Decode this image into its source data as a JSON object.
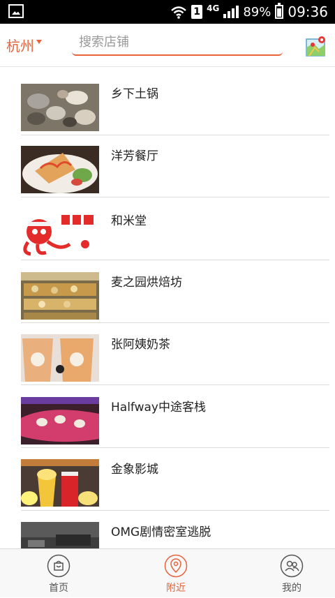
{
  "status_bar": {
    "sim": "1",
    "network": "4G",
    "battery": "89%",
    "time": "09:36"
  },
  "header": {
    "city": "杭州",
    "search_placeholder": "搜索店铺"
  },
  "stores": [
    {
      "name": "乡下土锅"
    },
    {
      "name": "洋芳餐厅"
    },
    {
      "name": "和米堂"
    },
    {
      "name": "麦之园烘焙坊"
    },
    {
      "name": "张阿姨奶茶"
    },
    {
      "name": "Halfway中途客栈"
    },
    {
      "name": "金象影城"
    },
    {
      "name": "OMG剧情密室逃脱"
    }
  ],
  "tabs": [
    {
      "label": "首页",
      "icon": "bag-icon",
      "active": false
    },
    {
      "label": "附近",
      "icon": "location-pin-icon",
      "active": true
    },
    {
      "label": "我的",
      "icon": "people-icon",
      "active": false
    }
  ],
  "colors": {
    "accent": "#e8623a",
    "inactive": "#555555"
  }
}
